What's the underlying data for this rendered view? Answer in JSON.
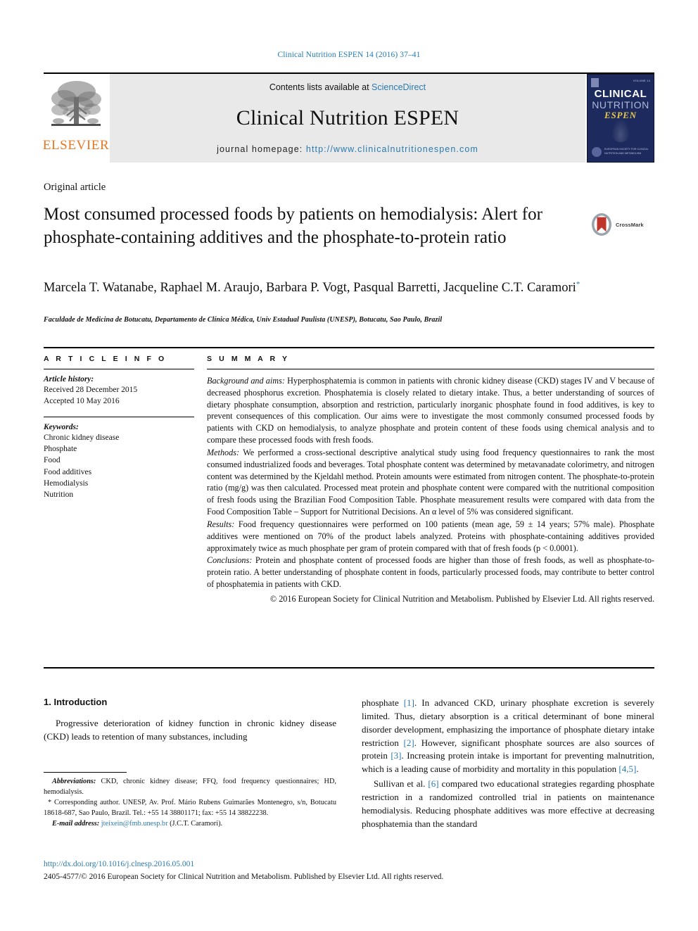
{
  "running_head": "Clinical Nutrition ESPEN 14 (2016) 37–41",
  "masthead": {
    "publisher_name": "ELSEVIER",
    "contents_prefix": "Contents lists available at ",
    "contents_link": "ScienceDirect",
    "journal_title": "Clinical Nutrition ESPEN",
    "homepage_prefix": "journal homepage: ",
    "homepage_url": "http://www.clinicalnutritionespen.com",
    "cover": {
      "date_text": "VOLUME 14",
      "line1": "CLINICAL",
      "line2": "NUTRITION",
      "line3": "ESPEN",
      "footer_text": "EUROPEAN SOCIETY FOR CLINICAL NUTRITION AND METABOLISM"
    }
  },
  "article": {
    "type": "Original article",
    "title": "Most consumed processed foods by patients on hemodialysis: Alert for phosphate-containing additives and the phosphate-to-protein ratio",
    "crossmark_label": "CrossMark",
    "authors": "Marcela T. Watanabe, Raphael M. Araujo, Barbara P. Vogt, Pasqual Barretti, Jacqueline C.T. Caramori",
    "author_marker": "*",
    "affiliation": "Faculdade de Medicina de Botucatu, Departamento de Clínica Médica, Univ Estadual Paulista (UNESP), Botucatu, Sao Paulo, Brazil"
  },
  "article_info": {
    "heading": "A R T I C L E   I N F O",
    "history_label": "Article history:",
    "received": "Received 28 December 2015",
    "accepted": "Accepted 10 May 2016",
    "keywords_label": "Keywords:",
    "keywords": [
      "Chronic kidney disease",
      "Phosphate",
      "Food",
      "Food additives",
      "Hemodialysis",
      "Nutrition"
    ]
  },
  "summary": {
    "heading": "S U M M A R Y",
    "background_label": "Background and aims:",
    "background_text": " Hyperphosphatemia is common in patients with chronic kidney disease (CKD) stages IV and V because of decreased phosphorus excretion. Phosphatemia is closely related to dietary intake. Thus, a better understanding of sources of dietary phosphate consumption, absorption and restriction, particularly inorganic phosphate found in food additives, is key to prevent consequences of this complication. Our aims were to investigate the most commonly consumed processed foods by patients with CKD on hemodialysis, to analyze phosphate and protein content of these foods using chemical analysis and to compare these processed foods with fresh foods.",
    "methods_label": "Methods:",
    "methods_text": " We performed a cross-sectional descriptive analytical study using food frequency questionnaires to rank the most consumed industrialized foods and beverages. Total phosphate content was determined by metavanadate colorimetry, and nitrogen content was determined by the Kjeldahl method. Protein amounts were estimated from nitrogen content. The phosphate-to-protein ratio (mg/g) was then calculated. Processed meat protein and phosphate content were compared with the nutritional composition of fresh foods using the Brazilian Food Composition Table. Phosphate measurement results were compared with data from the Food Composition Table – Support for Nutritional Decisions. An α level of 5% was considered significant.",
    "results_label": "Results:",
    "results_text": " Food frequency questionnaires were performed on 100 patients (mean age, 59 ± 14 years; 57% male). Phosphate additives were mentioned on 70% of the product labels analyzed. Proteins with phosphate-containing additives provided approximately twice as much phosphate per gram of protein compared with that of fresh foods (p < 0.0001).",
    "conclusions_label": "Conclusions:",
    "conclusions_text": " Protein and phosphate content of processed foods are higher than those of fresh foods, as well as phosphate-to-protein ratio. A better understanding of phosphate content in foods, particularly processed foods, may contribute to better control of phosphatemia in patients with CKD.",
    "copyright": "© 2016 European Society for Clinical Nutrition and Metabolism. Published by Elsevier Ltd. All rights reserved."
  },
  "body": {
    "intro_heading": "1. Introduction",
    "left_p1_a": "Progressive deterioration of kidney function in chronic kidney disease (CKD) leads to retention of many substances, including",
    "right_p1_a": "phosphate ",
    "right_p1_ref1": "[1]",
    "right_p1_b": ". In advanced CKD, urinary phosphate excretion is severely limited. Thus, dietary absorption is a critical determinant of bone mineral disorder development, emphasizing the importance of phosphate dietary intake restriction ",
    "right_p1_ref2": "[2]",
    "right_p1_c": ". However, significant phosphate sources are also sources of protein ",
    "right_p1_ref3": "[3]",
    "right_p1_d": ". Increasing protein intake is important for preventing malnutrition, which is a leading cause of morbidity and mortality in this population ",
    "right_p1_ref4": "[4,5]",
    "right_p1_e": ".",
    "right_p2_a": "Sullivan et al. ",
    "right_p2_ref1": "[6]",
    "right_p2_b": " compared two educational strategies regarding phosphate restriction in a randomized controlled trial in patients on maintenance hemodialysis. Reducing phosphate additives was more effective at decreasing phosphatemia than the standard"
  },
  "footnotes": {
    "abbrev_label": "Abbreviations:",
    "abbrev_text": " CKD, chronic kidney disease; FFQ, food frequency questionnaires; HD, hemodialysis.",
    "corresponding_marker": "*",
    "corresponding_text": " Corresponding author. UNESP, Av. Prof. Mário Rubens Guimarães Montenegro, s/n, Botucatu 18618-687, Sao Paulo, Brazil. Tel.: +55 14 38801171; fax: +55 14 38822238.",
    "email_label": "E-mail address:",
    "email": "jteixein@fmb.unesp.br",
    "email_suffix": " (J.C.T. Caramori)."
  },
  "footer": {
    "doi": "http://dx.doi.org/10.1016/j.clnesp.2016.05.001",
    "issn": "2405-4577/© 2016 European Society for Clinical Nutrition and Metabolism. Published by Elsevier Ltd. All rights reserved."
  },
  "colors": {
    "link": "#2a7ab0",
    "elsevier_orange": "#e87722",
    "cover_navy": "#1d2a5e",
    "crossmark_red": "#c0352b"
  }
}
